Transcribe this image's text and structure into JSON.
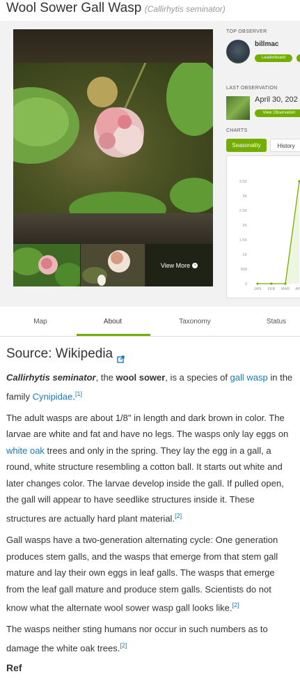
{
  "header": {
    "common_name": "Wool Sower Gall Wasp",
    "scientific_name": "(Callirhytis seminator)"
  },
  "photos": {
    "view_more_label": "View More",
    "thumbnails": [
      "thumbnail-1",
      "thumbnail-2"
    ]
  },
  "top_observer": {
    "label": "TOP OBSERVER",
    "username": "billmac",
    "leaderboard_label": "Leaderboard"
  },
  "last_observation": {
    "label": "LAST OBSERVATION",
    "date": "April 30, 202",
    "button_label": "View Observation"
  },
  "charts": {
    "label": "CHARTS",
    "tabs": [
      "Seasonality",
      "History"
    ],
    "active_tab": "Seasonality"
  },
  "chart_data": {
    "type": "line",
    "categories": [
      "JAN",
      "FEB",
      "MAR",
      "APR"
    ],
    "series": [
      {
        "values": [
          0,
          0,
          0,
          3500
        ]
      }
    ],
    "y_ticks": [
      "0",
      "500",
      "1K",
      "1.5K",
      "2K",
      "2.5K",
      "3K",
      "3.5K"
    ],
    "ylim": [
      0,
      3500
    ],
    "color": "#74ac00"
  },
  "tabs": {
    "map": "Map",
    "about": "About",
    "taxonomy": "Taxonomy",
    "status": "Status",
    "active": "About"
  },
  "about": {
    "source_heading": "Source: Wikipedia",
    "p1": {
      "sci_name": "Callirhytis seminator",
      "t1": ", the ",
      "common_bold": "wool sower",
      "t2": ", is a species of ",
      "link1": "gall wasp",
      "t3": " in the family ",
      "link2": "Cynipidae",
      "ref": "[1]"
    },
    "p2": {
      "t1": "The adult wasps are about 1/8\" in length and dark brown in color. The larvae are white and fat and have no legs. The wasps only lay eggs on ",
      "link": "white oak",
      "t2": " trees and only in the spring. They lay the egg in a gall, a round, white structure resembling a cotton ball. It starts out white and later changes color. The larvae develop inside the gall. If pulled open, the gall will appear to have seedlike structures inside it. These structures are actually hard plant material.",
      "ref": "[2]"
    },
    "p3": {
      "text": "Gall wasps have a two-generation alternating cycle: One generation produces stem galls, and the wasps that emerge from that stem gall mature and lay their own eggs in leaf galls. The wasps that emerge from the leaf gall mature and produce stem galls. Scientists do not know what the alternate wool sower wasp gall looks like.",
      "ref": "[2]"
    },
    "p4": {
      "text": "The wasps neither sting humans nor occur in such numbers as to damage the white oak trees.",
      "ref": "[2]"
    },
    "references_heading": "Ref"
  }
}
